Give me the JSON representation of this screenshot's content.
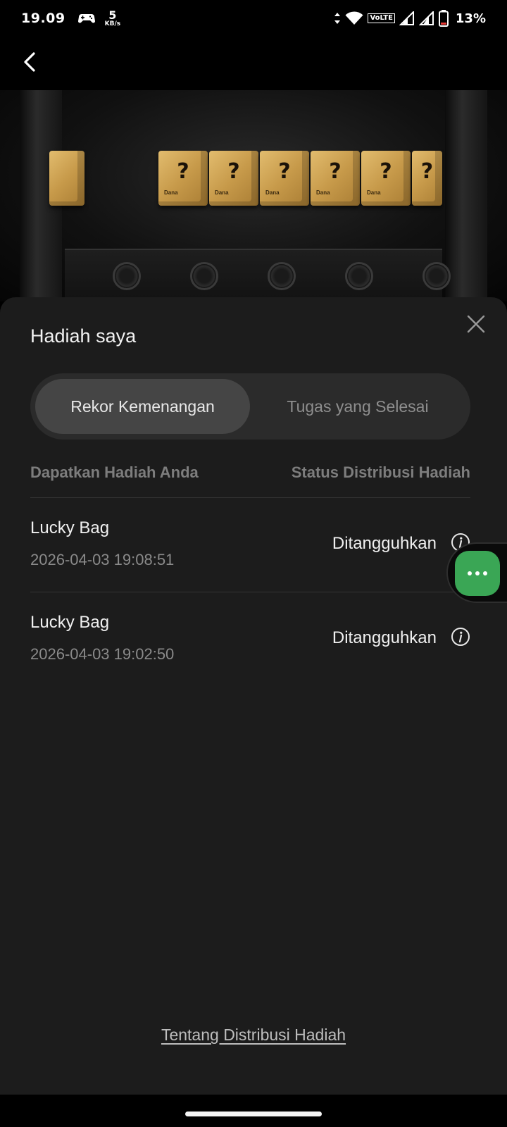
{
  "status_bar": {
    "time": "19.09",
    "net_speed_value": "5",
    "net_speed_unit": "KB/s",
    "volte_label": "VoLTE",
    "battery_percent": "13%",
    "icons": [
      "gamepad-icon",
      "data-arrows-icon",
      "wifi-icon",
      "volte-icon",
      "signal-icon",
      "signal-icon",
      "battery-icon"
    ]
  },
  "app_bar": {
    "back_icon": "chevron-left-icon"
  },
  "banner": {
    "box_mark": "?",
    "box_brand": "Dana",
    "box_count": 7
  },
  "sheet": {
    "title": "Hadiah saya",
    "close_icon": "close-icon",
    "tabs": [
      {
        "label": "Rekor Kemenangan",
        "active": true
      },
      {
        "label": "Tugas yang Selesai",
        "active": false
      }
    ],
    "columns": {
      "left": "Dapatkan Hadiah Anda",
      "right": "Status Distribusi Hadiah"
    },
    "records": [
      {
        "name": "Lucky Bag",
        "date": "2026-04-03 19:08:51",
        "status": "Ditangguhkan"
      },
      {
        "name": "Lucky Bag",
        "date": "2026-04-03 19:02:50",
        "status": "Ditangguhkan"
      }
    ],
    "footer_link": "Tentang Distribusi Hadiah"
  },
  "floating": {
    "icon": "more-dots-icon",
    "accent": "#3aa655"
  },
  "colors": {
    "sheet_bg": "#1c1c1c",
    "tab_active_bg": "#454545",
    "tab_container_bg": "#2b2b2b"
  }
}
